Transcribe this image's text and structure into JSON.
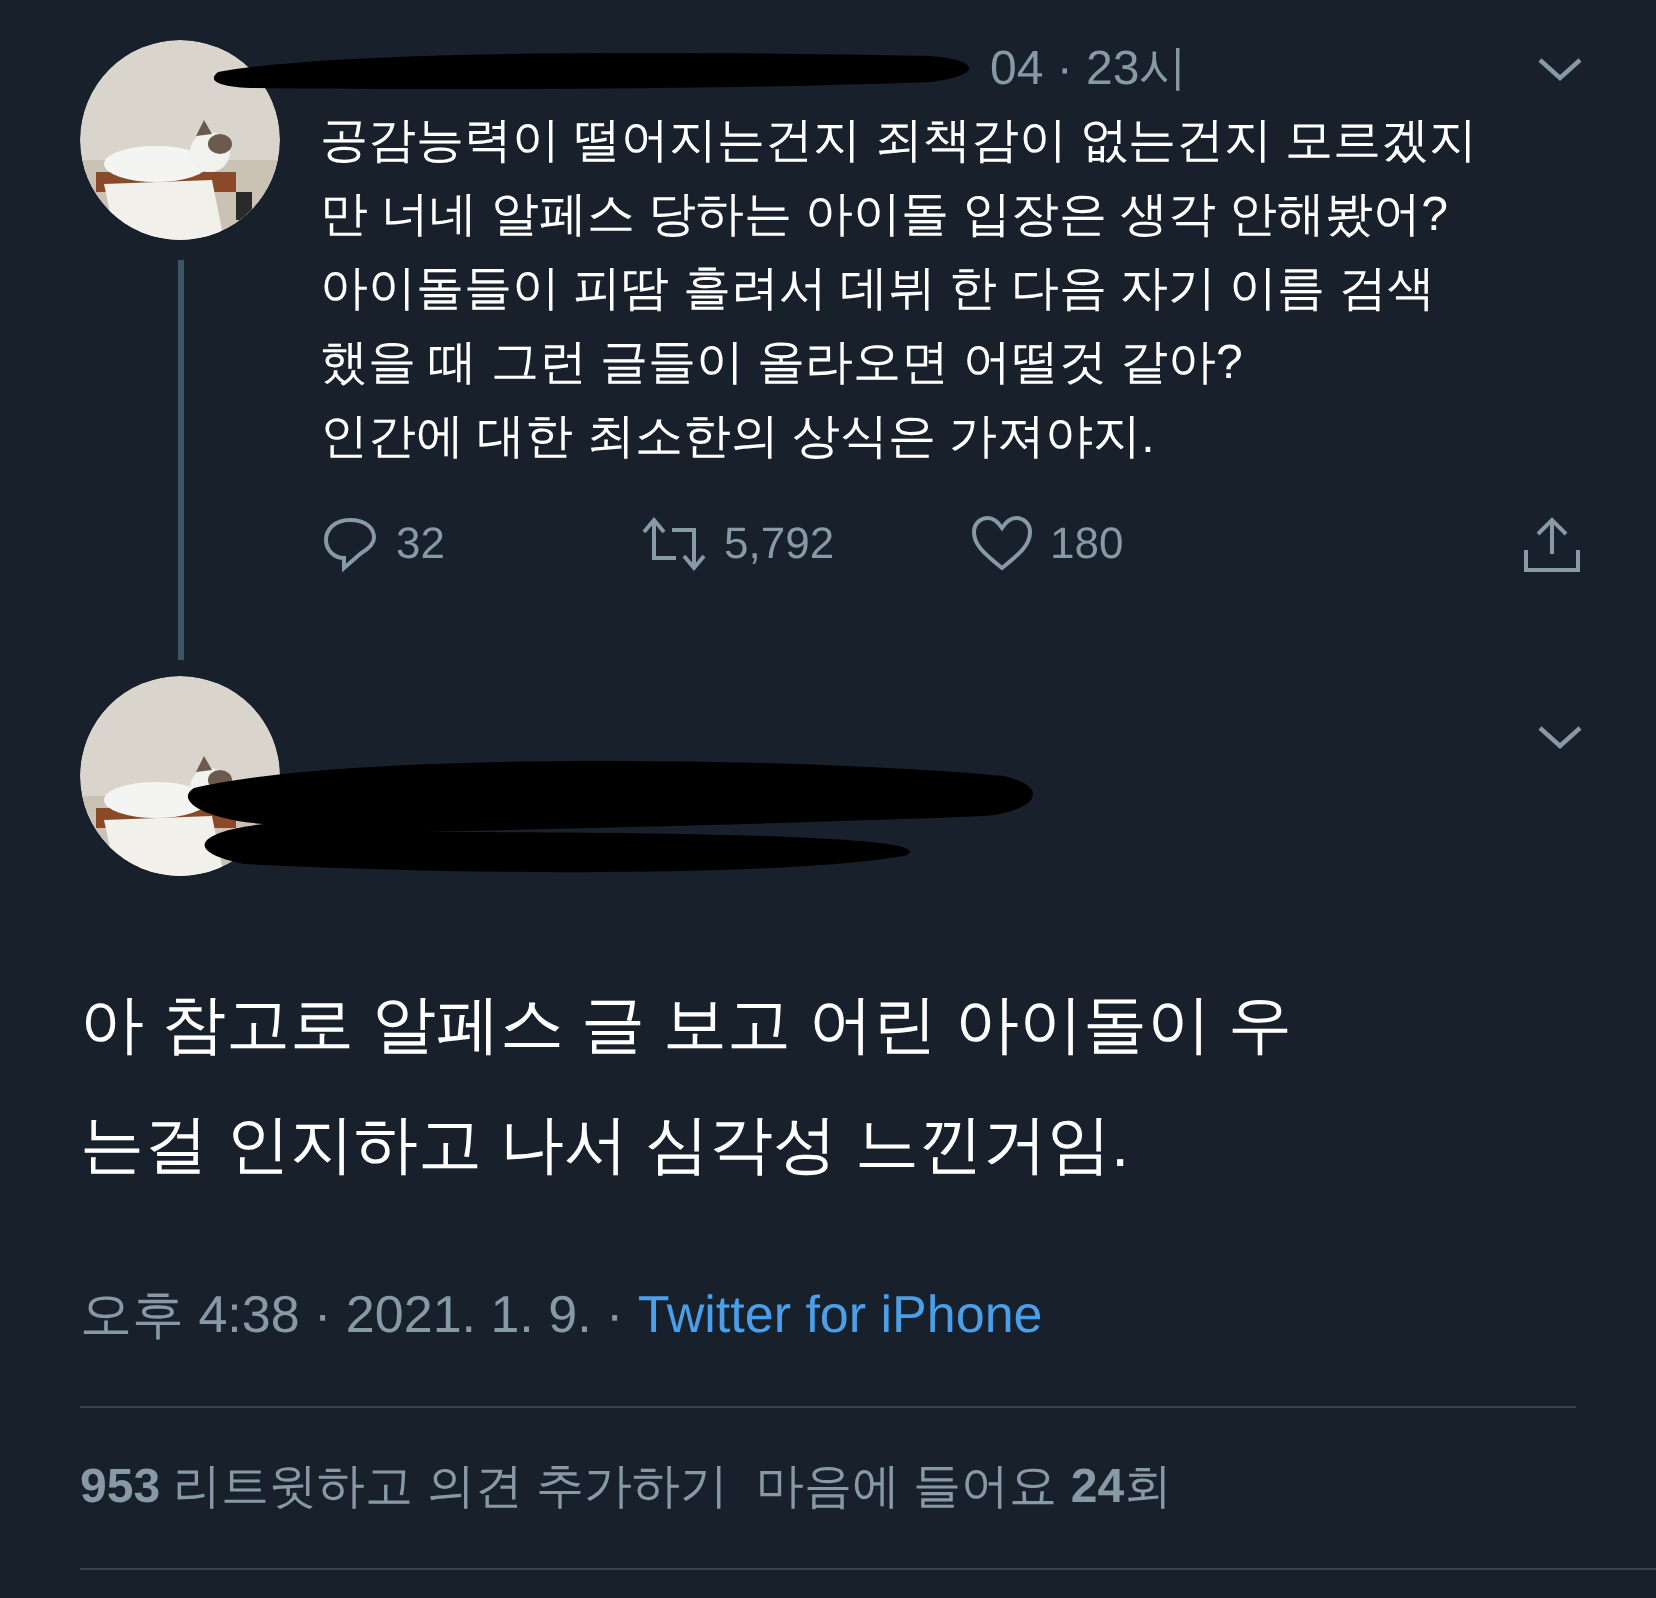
{
  "parent_tweet": {
    "meta": "04 · 23시",
    "body": "공감능력이 떨어지는건지 죄책감이 없는건지 모르겠지\n만 너네 알페스 당하는 아이돌 입장은 생각 안해봤어?\n아이돌들이 피땀 흘려서 데뷔 한 다음 자기 이름 검색\n했을 때 그런 글들이 올라오면 어떨것 같아?\n인간에 대한 최소한의 상식은 가져야지.",
    "actions": [
      {
        "kind": "reply",
        "count": "32"
      },
      {
        "kind": "retweet",
        "count": "5,792"
      },
      {
        "kind": "like",
        "count": "180"
      },
      {
        "kind": "share"
      }
    ]
  },
  "main_tweet": {
    "body": "아 참고로 알페스 글 보고 어린 아이돌이 우\n는걸 인지하고 나서 심각성 느낀거임.",
    "time": "오후 4:38 · 2021. 1. 9. · ",
    "source": "Twitter for iPhone",
    "stats": [
      "**953** 리트윗하고 의견 추가하기",
      "마음에 들어요 **24**회"
    ]
  }
}
